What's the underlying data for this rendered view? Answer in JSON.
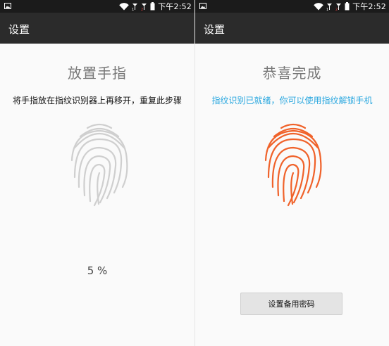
{
  "status_bar": {
    "time": "下午2:52"
  },
  "left_screen": {
    "app_title": "设置",
    "heading": "放置手指",
    "instruction": "将手指放在指纹识别器上再移开，重复此步骤",
    "progress_text": "5 %",
    "progress_percent": 5,
    "fingerprint_color": "#cfcfcf"
  },
  "right_screen": {
    "app_title": "设置",
    "heading": "恭喜完成",
    "message": "指纹识别已就绪，你可以使用指纹解锁手机",
    "backup_button_label": "设置备用密码",
    "fingerprint_color": "#f0622a"
  },
  "colors": {
    "appbar": "#2b2b2b",
    "statusbar": "#1b1b1b",
    "accent": "#29a7df"
  }
}
